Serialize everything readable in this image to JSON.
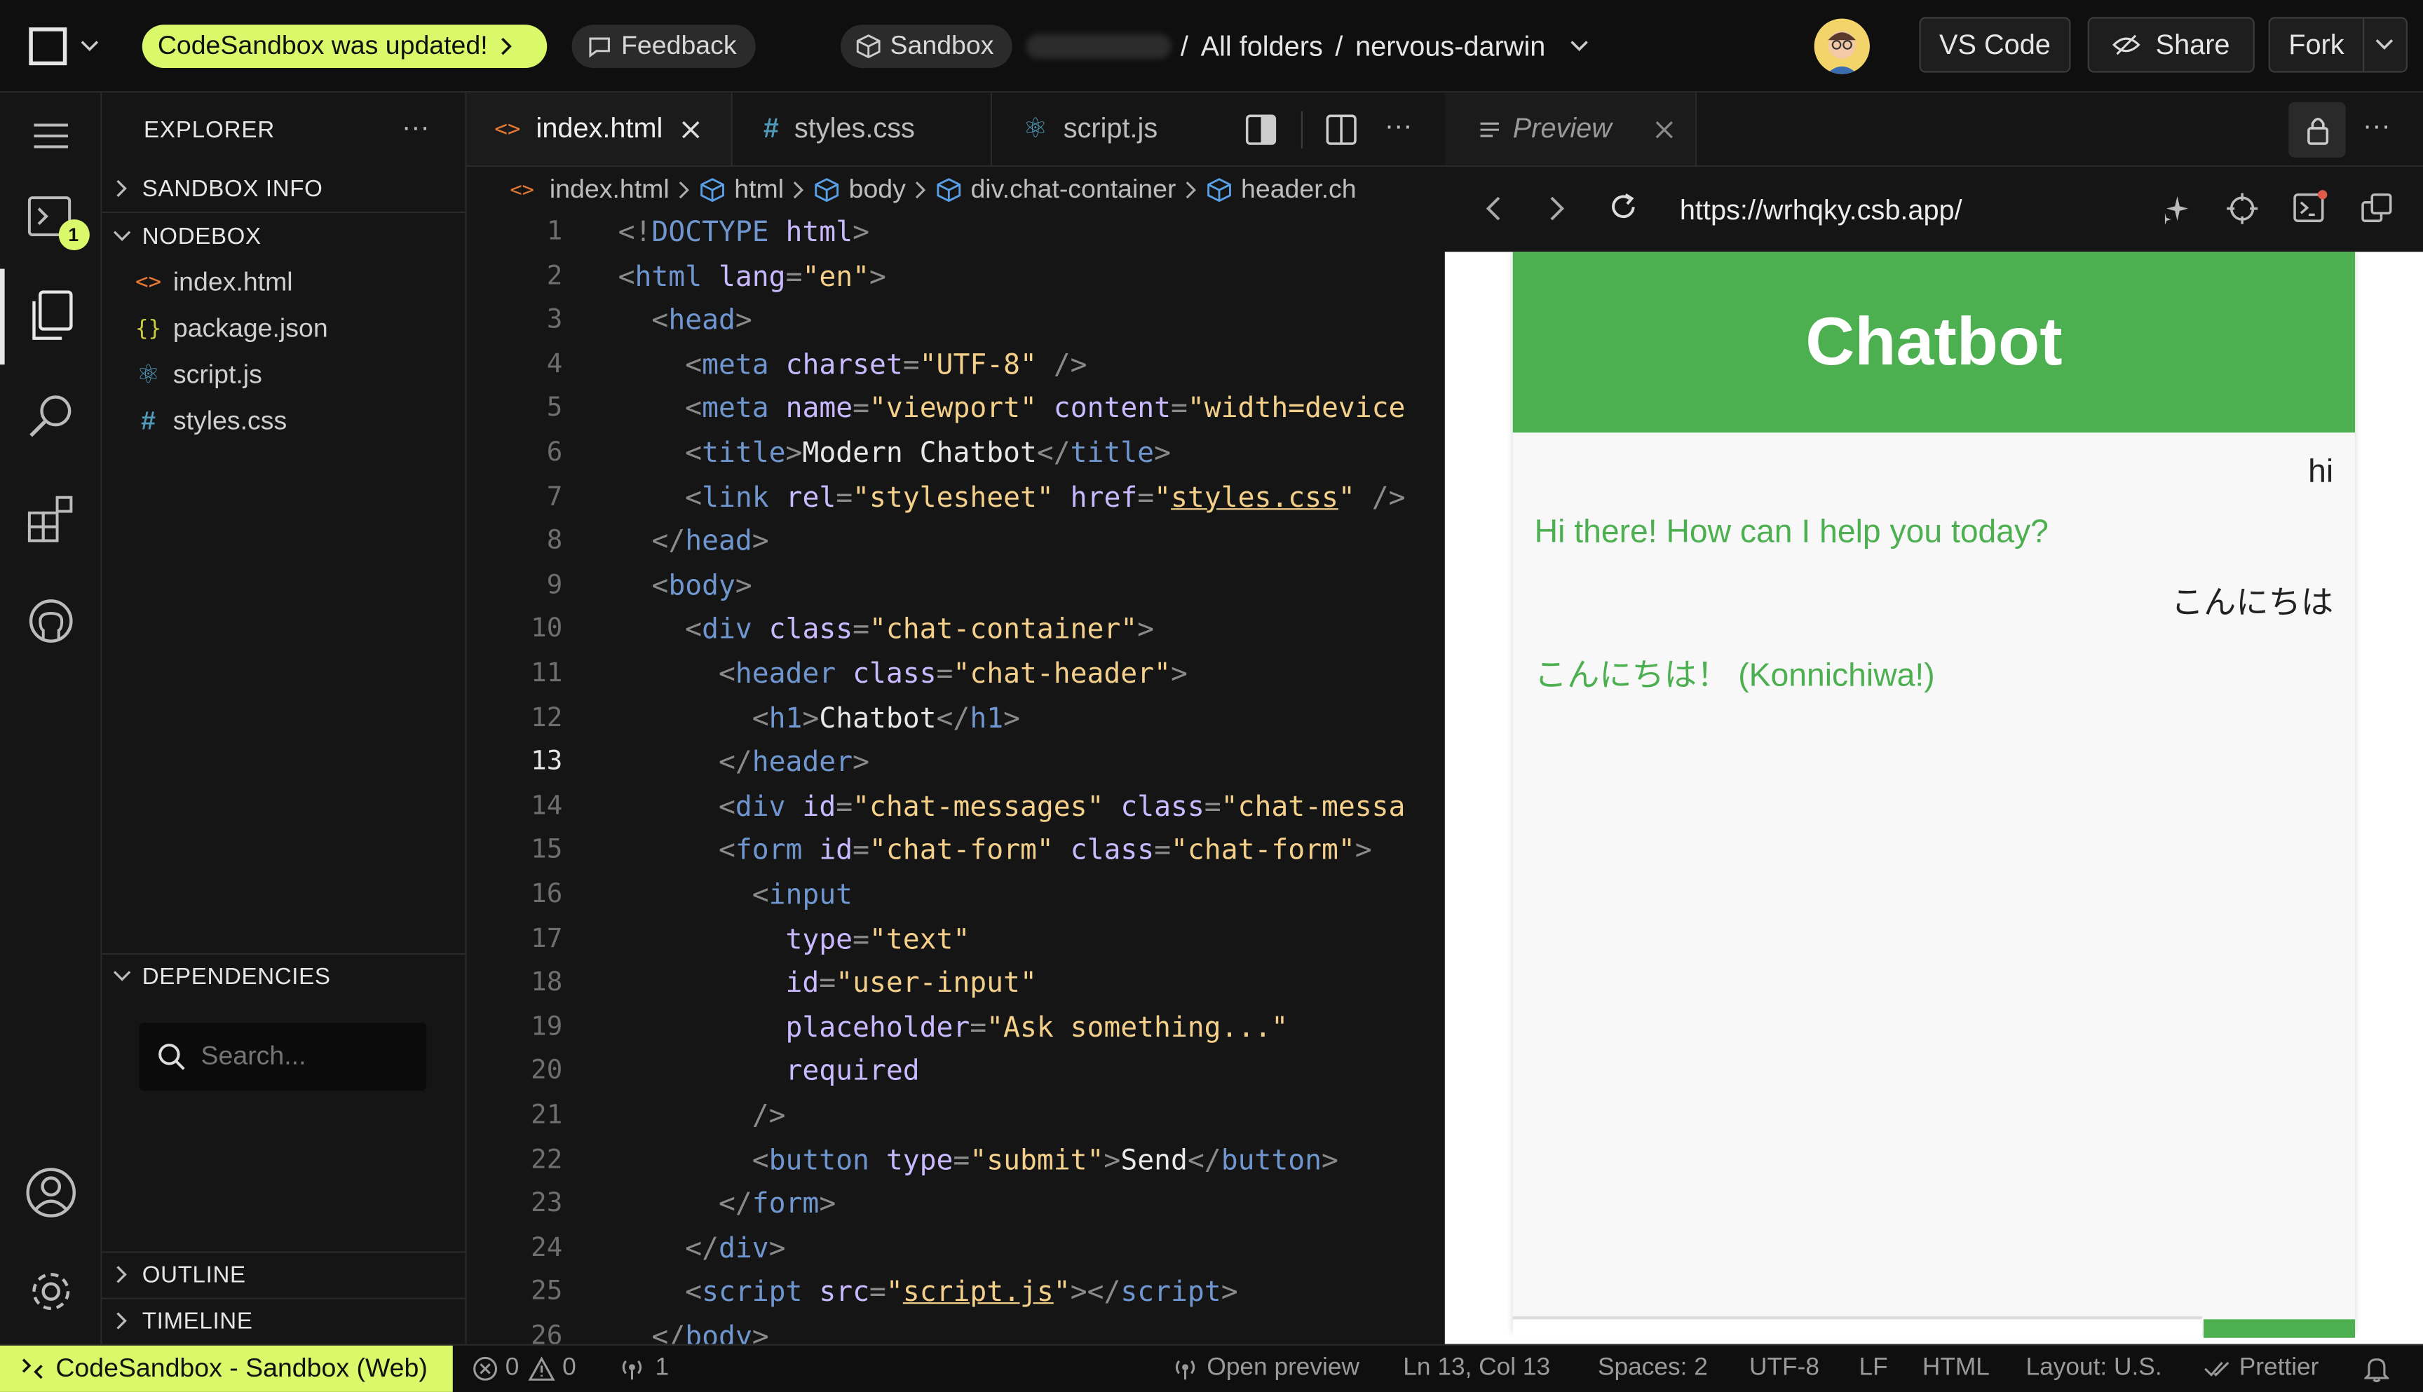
{
  "topbar": {
    "update_label": "CodeSandbox was updated!",
    "feedback_label": "Feedback",
    "sandbox_label": "Sandbox",
    "path_sep1": "/",
    "path_all_folders": "All folders",
    "path_sep2": "/",
    "project_name": "nervous-darwin",
    "vscode_label": "VS Code",
    "share_label": "Share",
    "fork_label": "Fork"
  },
  "activity": {
    "notification_count": "1"
  },
  "explorer": {
    "title": "EXPLORER",
    "sandbox_info": "SANDBOX INFO",
    "nodebox": "NODEBOX",
    "files": [
      {
        "name": "index.html",
        "icon": "<>"
      },
      {
        "name": "package.json",
        "icon": "{}"
      },
      {
        "name": "script.js",
        "icon": "⚛"
      },
      {
        "name": "styles.css",
        "icon": "#"
      }
    ],
    "dependencies": "DEPENDENCIES",
    "search_placeholder": "Search...",
    "outline": "OUTLINE",
    "timeline": "TIMELINE"
  },
  "editor": {
    "tabs": [
      {
        "label": "index.html",
        "icon": "<>"
      },
      {
        "label": "styles.css",
        "icon": "#"
      },
      {
        "label": "script.js",
        "icon": "⚛"
      }
    ],
    "breadcrumbs": [
      "index.html",
      "html",
      "body",
      "div.chat-container",
      "header.ch"
    ],
    "active_line": 13,
    "lines": [
      {
        "n": "1",
        "code": [
          [
            "p",
            "<!"
          ],
          [
            "t",
            "DOCTYPE"
          ],
          [
            "tx",
            " "
          ],
          [
            "a",
            "html"
          ],
          [
            "p",
            ">"
          ]
        ]
      },
      {
        "n": "2",
        "code": [
          [
            "p",
            "<"
          ],
          [
            "t",
            "html"
          ],
          [
            "tx",
            " "
          ],
          [
            "a",
            "lang"
          ],
          [
            "p",
            "="
          ],
          [
            "s",
            "\"en\""
          ],
          [
            "p",
            ">"
          ]
        ]
      },
      {
        "n": "3",
        "code": [
          [
            "tx",
            "  "
          ],
          [
            "p",
            "<"
          ],
          [
            "t",
            "head"
          ],
          [
            "p",
            ">"
          ]
        ]
      },
      {
        "n": "4",
        "code": [
          [
            "tx",
            "    "
          ],
          [
            "p",
            "<"
          ],
          [
            "t",
            "meta"
          ],
          [
            "tx",
            " "
          ],
          [
            "a",
            "charset"
          ],
          [
            "p",
            "="
          ],
          [
            "s",
            "\"UTF-8\""
          ],
          [
            "tx",
            " "
          ],
          [
            "p",
            "/>"
          ]
        ]
      },
      {
        "n": "5",
        "code": [
          [
            "tx",
            "    "
          ],
          [
            "p",
            "<"
          ],
          [
            "t",
            "meta"
          ],
          [
            "tx",
            " "
          ],
          [
            "a",
            "name"
          ],
          [
            "p",
            "="
          ],
          [
            "s",
            "\"viewport\""
          ],
          [
            "tx",
            " "
          ],
          [
            "a",
            "content"
          ],
          [
            "p",
            "="
          ],
          [
            "s",
            "\"width=device"
          ]
        ]
      },
      {
        "n": "6",
        "code": [
          [
            "tx",
            "    "
          ],
          [
            "p",
            "<"
          ],
          [
            "t",
            "title"
          ],
          [
            "p",
            ">"
          ],
          [
            "tx",
            "Modern Chatbot"
          ],
          [
            "p",
            "</"
          ],
          [
            "t",
            "title"
          ],
          [
            "p",
            ">"
          ]
        ]
      },
      {
        "n": "7",
        "code": [
          [
            "tx",
            "    "
          ],
          [
            "p",
            "<"
          ],
          [
            "t",
            "link"
          ],
          [
            "tx",
            " "
          ],
          [
            "a",
            "rel"
          ],
          [
            "p",
            "="
          ],
          [
            "s",
            "\"stylesheet\""
          ],
          [
            "tx",
            " "
          ],
          [
            "a",
            "href"
          ],
          [
            "p",
            "="
          ],
          [
            "s",
            "\""
          ],
          [
            "su",
            "styles.css"
          ],
          [
            "s",
            "\""
          ],
          [
            "tx",
            " "
          ],
          [
            "p",
            "/>"
          ]
        ]
      },
      {
        "n": "8",
        "code": [
          [
            "tx",
            "  "
          ],
          [
            "p",
            "</"
          ],
          [
            "t",
            "head"
          ],
          [
            "p",
            ">"
          ]
        ]
      },
      {
        "n": "9",
        "code": [
          [
            "tx",
            "  "
          ],
          [
            "p",
            "<"
          ],
          [
            "t",
            "body"
          ],
          [
            "p",
            ">"
          ]
        ]
      },
      {
        "n": "10",
        "code": [
          [
            "tx",
            "    "
          ],
          [
            "p",
            "<"
          ],
          [
            "t",
            "div"
          ],
          [
            "tx",
            " "
          ],
          [
            "a",
            "class"
          ],
          [
            "p",
            "="
          ],
          [
            "s",
            "\"chat-container\""
          ],
          [
            "p",
            ">"
          ]
        ]
      },
      {
        "n": "11",
        "code": [
          [
            "tx",
            "      "
          ],
          [
            "p",
            "<"
          ],
          [
            "t",
            "header"
          ],
          [
            "tx",
            " "
          ],
          [
            "a",
            "class"
          ],
          [
            "p",
            "="
          ],
          [
            "s",
            "\"chat-header\""
          ],
          [
            "p",
            ">"
          ]
        ]
      },
      {
        "n": "12",
        "code": [
          [
            "tx",
            "        "
          ],
          [
            "p",
            "<"
          ],
          [
            "t",
            "h1"
          ],
          [
            "p",
            ">"
          ],
          [
            "tx",
            "Chatbot"
          ],
          [
            "p",
            "</"
          ],
          [
            "t",
            "h1"
          ],
          [
            "p",
            ">"
          ]
        ]
      },
      {
        "n": "13",
        "code": [
          [
            "tx",
            "      "
          ],
          [
            "p",
            "</"
          ],
          [
            "t",
            "header"
          ],
          [
            "p",
            ">"
          ]
        ]
      },
      {
        "n": "14",
        "code": [
          [
            "tx",
            "      "
          ],
          [
            "p",
            "<"
          ],
          [
            "t",
            "div"
          ],
          [
            "tx",
            " "
          ],
          [
            "a",
            "id"
          ],
          [
            "p",
            "="
          ],
          [
            "s",
            "\"chat-messages\""
          ],
          [
            "tx",
            " "
          ],
          [
            "a",
            "class"
          ],
          [
            "p",
            "="
          ],
          [
            "s",
            "\"chat-messa"
          ]
        ]
      },
      {
        "n": "15",
        "code": [
          [
            "tx",
            "      "
          ],
          [
            "p",
            "<"
          ],
          [
            "t",
            "form"
          ],
          [
            "tx",
            " "
          ],
          [
            "a",
            "id"
          ],
          [
            "p",
            "="
          ],
          [
            "s",
            "\"chat-form\""
          ],
          [
            "tx",
            " "
          ],
          [
            "a",
            "class"
          ],
          [
            "p",
            "="
          ],
          [
            "s",
            "\"chat-form\""
          ],
          [
            "p",
            ">"
          ]
        ]
      },
      {
        "n": "16",
        "code": [
          [
            "tx",
            "        "
          ],
          [
            "p",
            "<"
          ],
          [
            "t",
            "input"
          ]
        ]
      },
      {
        "n": "17",
        "code": [
          [
            "tx",
            "          "
          ],
          [
            "a",
            "type"
          ],
          [
            "p",
            "="
          ],
          [
            "s",
            "\"text\""
          ]
        ]
      },
      {
        "n": "18",
        "code": [
          [
            "tx",
            "          "
          ],
          [
            "a",
            "id"
          ],
          [
            "p",
            "="
          ],
          [
            "s",
            "\"user-input\""
          ]
        ]
      },
      {
        "n": "19",
        "code": [
          [
            "tx",
            "          "
          ],
          [
            "a",
            "placeholder"
          ],
          [
            "p",
            "="
          ],
          [
            "s",
            "\"Ask something...\""
          ]
        ]
      },
      {
        "n": "20",
        "code": [
          [
            "tx",
            "          "
          ],
          [
            "a",
            "required"
          ]
        ]
      },
      {
        "n": "21",
        "code": [
          [
            "tx",
            "        "
          ],
          [
            "p",
            "/>"
          ]
        ]
      },
      {
        "n": "22",
        "code": [
          [
            "tx",
            "        "
          ],
          [
            "p",
            "<"
          ],
          [
            "t",
            "button"
          ],
          [
            "tx",
            " "
          ],
          [
            "a",
            "type"
          ],
          [
            "p",
            "="
          ],
          [
            "s",
            "\"submit\""
          ],
          [
            "p",
            ">"
          ],
          [
            "tx",
            "Send"
          ],
          [
            "p",
            "</"
          ],
          [
            "t",
            "button"
          ],
          [
            "p",
            ">"
          ]
        ]
      },
      {
        "n": "23",
        "code": [
          [
            "tx",
            "      "
          ],
          [
            "p",
            "</"
          ],
          [
            "t",
            "form"
          ],
          [
            "p",
            ">"
          ]
        ]
      },
      {
        "n": "24",
        "code": [
          [
            "tx",
            "    "
          ],
          [
            "p",
            "</"
          ],
          [
            "t",
            "div"
          ],
          [
            "p",
            ">"
          ]
        ]
      },
      {
        "n": "25",
        "code": [
          [
            "tx",
            "    "
          ],
          [
            "p",
            "<"
          ],
          [
            "t",
            "script"
          ],
          [
            "tx",
            " "
          ],
          [
            "a",
            "src"
          ],
          [
            "p",
            "="
          ],
          [
            "s",
            "\""
          ],
          [
            "su",
            "script.js"
          ],
          [
            "s",
            "\""
          ],
          [
            "p",
            "></"
          ],
          [
            "t",
            "script"
          ],
          [
            "p",
            ">"
          ]
        ]
      },
      {
        "n": "26",
        "code": [
          [
            "tx",
            "  "
          ],
          [
            "p",
            "</"
          ],
          [
            "t",
            "body"
          ],
          [
            "p",
            ">"
          ]
        ]
      }
    ]
  },
  "preview": {
    "tab_label": "Preview",
    "url": "https://wrhqky.csb.app/",
    "chat_title": "Chatbot",
    "messages": [
      {
        "from": "user",
        "text": "hi"
      },
      {
        "from": "bot",
        "text": "Hi there! How can I help you today?"
      },
      {
        "from": "user",
        "text": "こんにちは"
      },
      {
        "from": "bot",
        "text": "こんにちは！ (Konnichiwa!)"
      }
    ],
    "bot_color": "#4caf50",
    "header_color": "#4caf50"
  },
  "statusbar": {
    "remote_label": "CodeSandbox - Sandbox (Web)",
    "errors": "0",
    "warnings": "0",
    "ports": "1",
    "open_preview": "Open preview",
    "cursor": "Ln 13, Col 13",
    "spaces": "Spaces: 2",
    "encoding": "UTF-8",
    "eol": "LF",
    "language": "HTML",
    "layout": "Layout: U.S.",
    "formatter": "Prettier"
  }
}
